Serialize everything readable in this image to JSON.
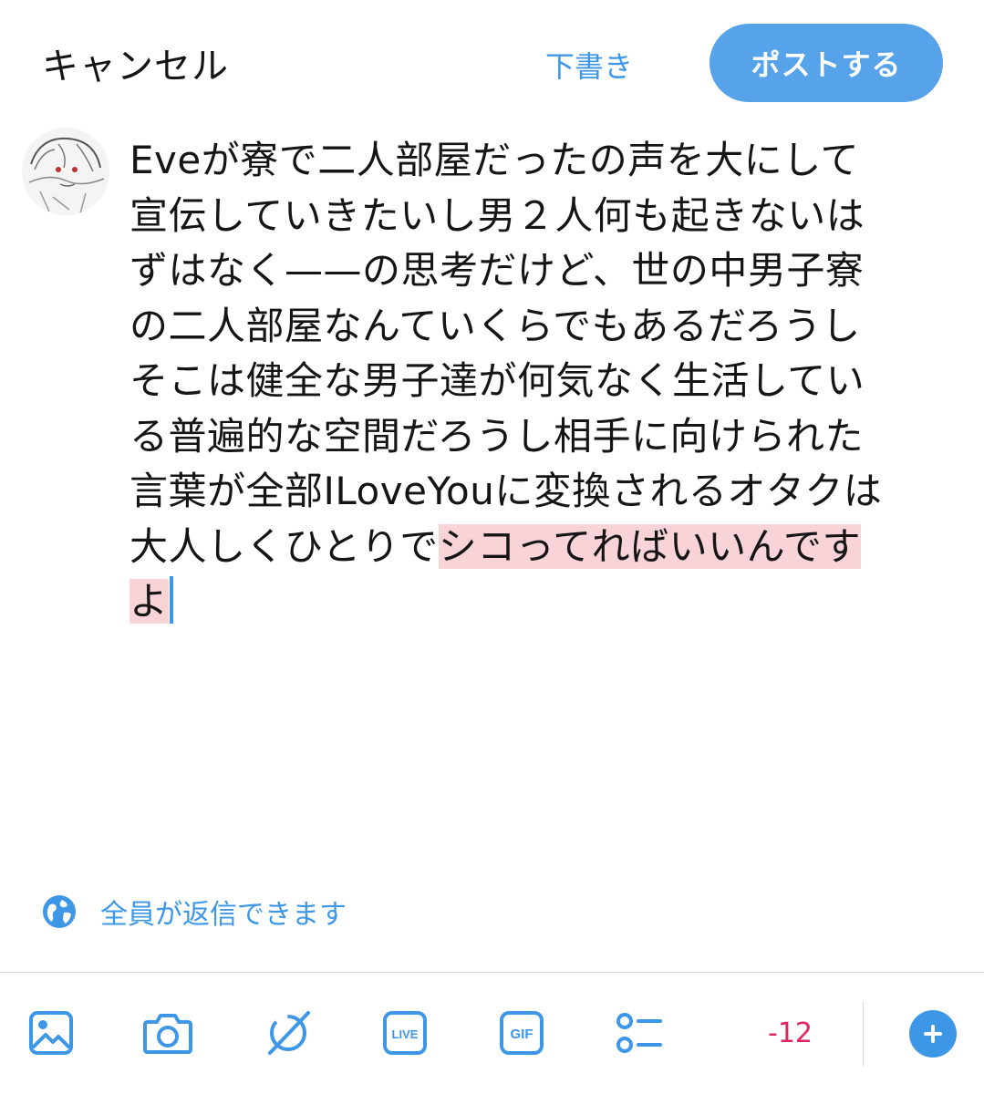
{
  "header": {
    "cancel_label": "キャンセル",
    "draft_label": "下書き",
    "post_label": "ポストする"
  },
  "compose": {
    "lines": [
      "Eveが寮で二人部屋だったの声を大にして",
      "宣伝していきたいし男２人何も起きないは",
      "ずはなく——の思考だけど、世の中男子寮",
      "の二人部屋なんていくらでもあるだろうし",
      "そこは健全な男子達が何気なく生活してい",
      "る普遍的な空間だろうし相手に向けられた",
      "言葉が全部ILoveYouに変換されるオタクは"
    ],
    "line8_plain": "大人しくひとりで",
    "line8_highlight": "シコってればいいんです",
    "line9_highlight": "よ",
    "highlight_color": "#f8d4d9"
  },
  "reply_setting": {
    "label": "全員が返信できます",
    "icon": "globe-icon"
  },
  "toolbar": {
    "icons": [
      "image-icon",
      "camera-icon",
      "grok-icon",
      "live-icon",
      "gif-icon",
      "poll-icon"
    ],
    "live_text": "LIVE",
    "gif_text": "GIF",
    "counter": "-12",
    "add_icon": "plus-icon"
  },
  "colors": {
    "accent": "#3e97e6",
    "button": "#56a3ea",
    "counter": "#e0245e"
  }
}
